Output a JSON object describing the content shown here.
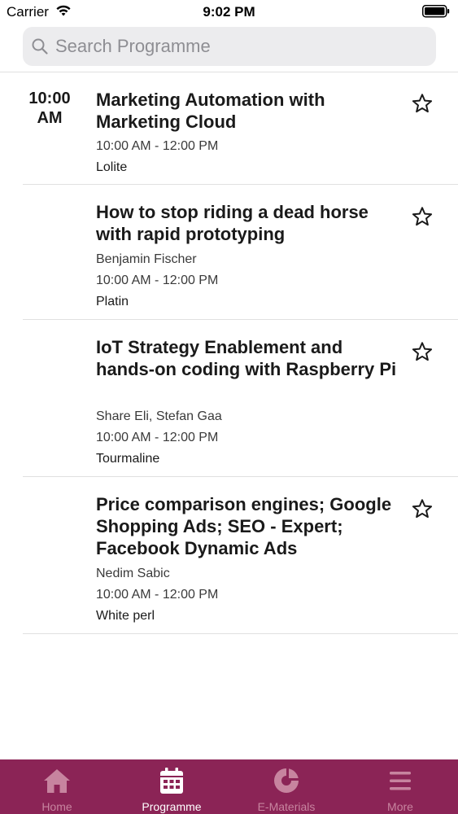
{
  "status_bar": {
    "carrier": "Carrier",
    "time": "9:02 PM"
  },
  "search": {
    "placeholder": "Search Programme"
  },
  "time_slot": {
    "label_line1": "10:00",
    "label_line2": "AM"
  },
  "sessions": [
    {
      "title": "Marketing Automation with Marketing Cloud",
      "speakers": "",
      "time": "10:00 AM - 12:00 PM",
      "room": "Lolite",
      "favorited": false
    },
    {
      "title": "How to stop riding a dead horse with rapid prototyping",
      "speakers": "Benjamin Fischer",
      "time": "10:00 AM - 12:00 PM",
      "room": "Platin",
      "favorited": false
    },
    {
      "title": "IoT Strategy Enablement and hands-on coding with Raspberry Pi",
      "speakers": "Share Eli, Stefan  Gaa",
      "time": "10:00 AM - 12:00 PM",
      "room": "Tourmaline",
      "favorited": false
    },
    {
      "title": "Price comparison engines; Google Shopping Ads; SEO - Expert; Facebook Dynamic Ads",
      "speakers": "Nedim Sabic",
      "time": "10:00 AM - 12:00 PM",
      "room": "White perl",
      "favorited": false
    }
  ],
  "tab_bar": {
    "background": "#8b2456",
    "active_color": "#ffffff",
    "inactive_color": "#c7849f",
    "tabs": [
      {
        "label": "Home",
        "icon": "home-icon",
        "active": false
      },
      {
        "label": "Programme",
        "icon": "calendar-icon",
        "active": true
      },
      {
        "label": "E-Materials",
        "icon": "e-materials-icon",
        "active": false
      },
      {
        "label": "More",
        "icon": "menu-icon",
        "active": false
      }
    ]
  }
}
